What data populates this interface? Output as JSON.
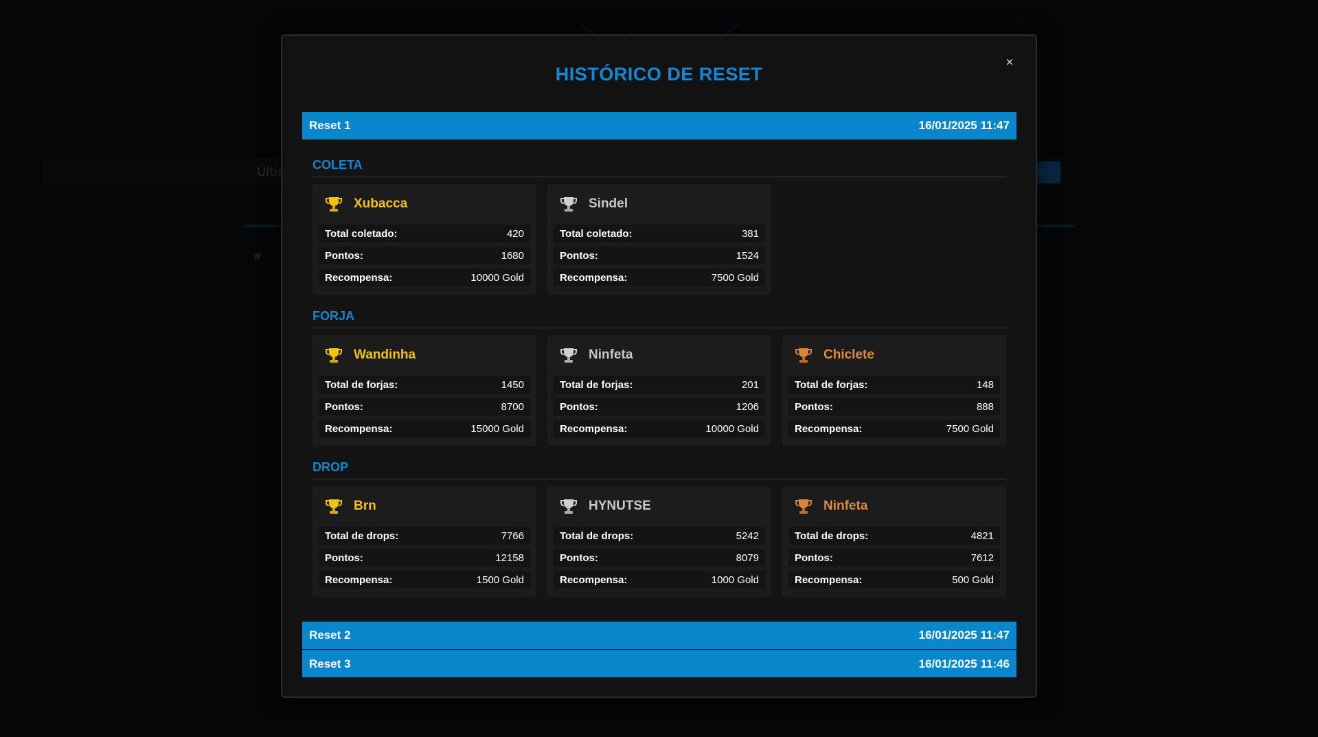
{
  "background_page": {
    "filter_text": "Últim",
    "table_header": "#"
  },
  "modal": {
    "title": "HISTÓRICO DE RESET",
    "close_label": "×"
  },
  "colors": {
    "accent": "#0a86cc",
    "title": "#1289d6",
    "gold": "#f2c311",
    "silver": "#c8c8c8",
    "bronze": "#dd8b3c"
  },
  "resets": [
    {
      "label": "Reset 1",
      "date": "16/01/2025 11:47",
      "expanded": true,
      "sections": [
        {
          "title": "COLETA",
          "cards": [
            {
              "rank_icon": "gold-trophy-icon",
              "name": "Xubacca",
              "rows": [
                {
                  "label": "Total coletado:",
                  "value": "420"
                },
                {
                  "label": "Pontos:",
                  "value": "1680"
                },
                {
                  "label": "Recompensa:",
                  "value": "10000 Gold"
                }
              ]
            },
            {
              "rank_icon": "silver-trophy-icon",
              "name": "Sindel",
              "rows": [
                {
                  "label": "Total coletado:",
                  "value": "381"
                },
                {
                  "label": "Pontos:",
                  "value": "1524"
                },
                {
                  "label": "Recompensa:",
                  "value": "7500 Gold"
                }
              ]
            }
          ]
        },
        {
          "title": "FORJA",
          "cards": [
            {
              "rank_icon": "gold-trophy-icon",
              "name": "Wandinha",
              "rows": [
                {
                  "label": "Total de forjas:",
                  "value": "1450"
                },
                {
                  "label": "Pontos:",
                  "value": "8700"
                },
                {
                  "label": "Recompensa:",
                  "value": "15000 Gold"
                }
              ]
            },
            {
              "rank_icon": "silver-trophy-icon",
              "name": "Ninfeta",
              "rows": [
                {
                  "label": "Total de forjas:",
                  "value": "201"
                },
                {
                  "label": "Pontos:",
                  "value": "1206"
                },
                {
                  "label": "Recompensa:",
                  "value": "10000 Gold"
                }
              ]
            },
            {
              "rank_icon": "bronze-trophy-icon",
              "name": "Chiclete",
              "rows": [
                {
                  "label": "Total de forjas:",
                  "value": "148"
                },
                {
                  "label": "Pontos:",
                  "value": "888"
                },
                {
                  "label": "Recompensa:",
                  "value": "7500 Gold"
                }
              ]
            }
          ]
        },
        {
          "title": "DROP",
          "cards": [
            {
              "rank_icon": "gold-trophy-icon",
              "name": "Brn",
              "rows": [
                {
                  "label": "Total de drops:",
                  "value": "7766"
                },
                {
                  "label": "Pontos:",
                  "value": "12158"
                },
                {
                  "label": "Recompensa:",
                  "value": "1500 Gold"
                }
              ]
            },
            {
              "rank_icon": "silver-trophy-icon",
              "name": "HYNUTSE",
              "rows": [
                {
                  "label": "Total de drops:",
                  "value": "5242"
                },
                {
                  "label": "Pontos:",
                  "value": "8079"
                },
                {
                  "label": "Recompensa:",
                  "value": "1000 Gold"
                }
              ]
            },
            {
              "rank_icon": "bronze-trophy-icon",
              "name": "Ninfeta",
              "rows": [
                {
                  "label": "Total de drops:",
                  "value": "4821"
                },
                {
                  "label": "Pontos:",
                  "value": "7612"
                },
                {
                  "label": "Recompensa:",
                  "value": "500 Gold"
                }
              ]
            }
          ]
        }
      ]
    },
    {
      "label": "Reset 2",
      "date": "16/01/2025 11:47",
      "expanded": false
    },
    {
      "label": "Reset 3",
      "date": "16/01/2025 11:46",
      "expanded": false
    }
  ]
}
